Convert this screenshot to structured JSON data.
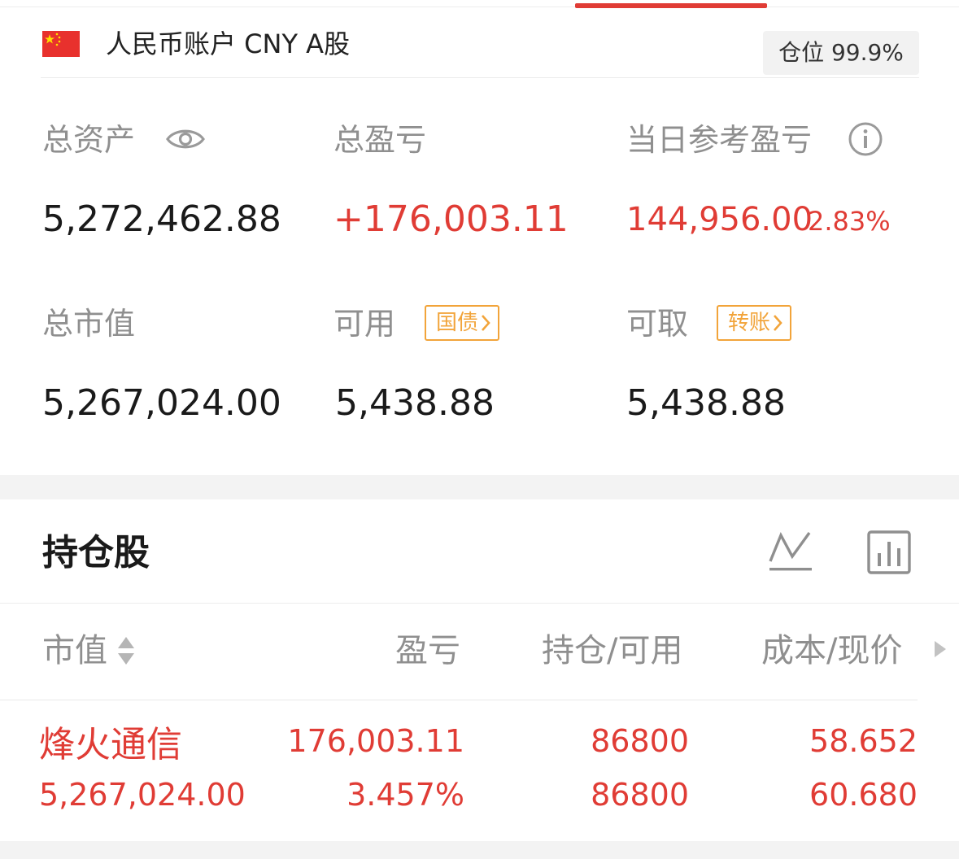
{
  "account": {
    "name": "人民币账户 CNY A股",
    "position_label": "仓位 99.9%"
  },
  "stats": {
    "total_assets": {
      "label": "总资产",
      "value": "5,272,462.88"
    },
    "total_pnl": {
      "label": "总盈亏",
      "value": "+176,003.11"
    },
    "daily_pnl": {
      "label": "当日参考盈亏",
      "value": "144,956.00",
      "pct": "2.83%"
    },
    "market_value": {
      "label": "总市值",
      "value": "5,267,024.00"
    },
    "available": {
      "label": "可用",
      "tag": "国债",
      "value": "5,438.88"
    },
    "withdrawable": {
      "label": "可取",
      "tag": "转账",
      "value": "5,438.88"
    }
  },
  "holdings": {
    "title": "持仓股",
    "columns": [
      "市值",
      "盈亏",
      "持仓/可用",
      "成本/现价"
    ],
    "rows": [
      {
        "name": "烽火通信",
        "market_value": "5,267,024.00",
        "pnl": "176,003.11",
        "pnl_pct": "3.457%",
        "position": "86800",
        "available": "86800",
        "cost": "58.652",
        "price": "60.680"
      }
    ]
  },
  "colors": {
    "accent_red": "#e03c35",
    "tag_orange": "#f2a43a",
    "label_gray": "#8f8f8f"
  },
  "icons": [
    "china-flag-icon",
    "eye-icon",
    "info-icon",
    "trend-line-icon",
    "bar-chart-icon",
    "sort-icon",
    "chevron-right-icon"
  ]
}
